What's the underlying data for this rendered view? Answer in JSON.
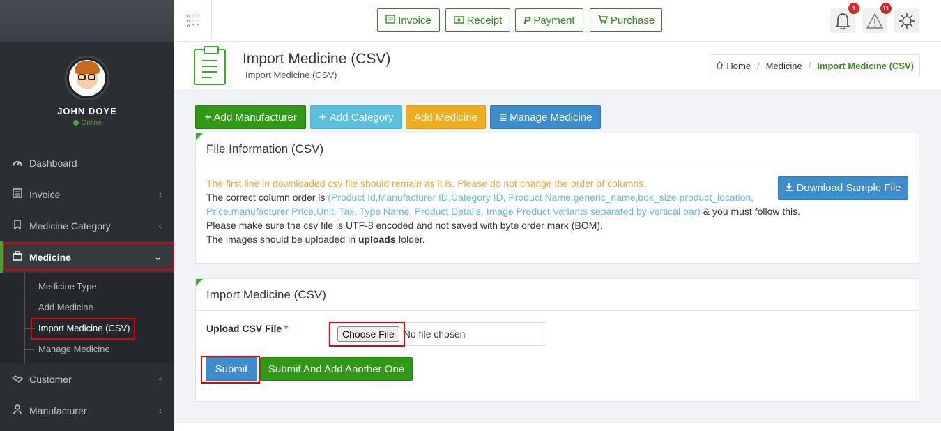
{
  "user": {
    "name": "JOHN DOYE",
    "status": "Online"
  },
  "sidebar": {
    "items": [
      {
        "label": "Dashboard",
        "icon": "dashboard-icon"
      },
      {
        "label": "Invoice",
        "icon": "invoice-icon"
      },
      {
        "label": "Medicine Category",
        "icon": "category-icon"
      },
      {
        "label": "Medicine",
        "icon": "medicine-icon"
      },
      {
        "label": "Customer",
        "icon": "handshake-icon"
      },
      {
        "label": "Manufacturer",
        "icon": "manufacturer-icon"
      }
    ],
    "submenu": [
      "Medicine Type",
      "Add Medicine",
      "Import Medicine (CSV)",
      "Manage Medicine"
    ]
  },
  "topbar": {
    "buttons": [
      "Invoice",
      "Receipt",
      "Payment",
      "Purchase"
    ],
    "notifications_count": "1",
    "alerts_count": "11"
  },
  "page": {
    "title": "Import Medicine (CSV)",
    "subtitle": "Import Medicine (CSV)",
    "breadcrumb": [
      "Home",
      "Medicine",
      "Import Medicine (CSV)"
    ]
  },
  "actions": {
    "add_manufacturer": "Add Manufacturer",
    "add_category": "Add Category",
    "add_medicine": "Add Medicine",
    "manage_medicine": "Manage Medicine"
  },
  "file_info": {
    "title": "File Information (CSV)",
    "warning": "The first line in downloaded csv file should remain as it is. Please do not change the order of columns.",
    "order_prefix": "The correct column order is ",
    "columns_line1": "(Product Id,Manufacturer ID,Category ID, Product Name,generic_name,box_size,product_location,",
    "columns_line2": "Price,manufacturer Price,Unit, Tax, Type Name, Product Details, Image Product Variants separated by vertical bar)",
    "order_suffix": " & you must follow this.",
    "encoding_note": "Please make sure the csv file is UTF-8 encoded and not saved with byte order mark (BOM).",
    "images_prefix": "The images should be uploaded in ",
    "images_folder": "uploads",
    "images_suffix": " folder.",
    "download_button": "Download Sample File"
  },
  "import_form": {
    "title": "Import Medicine (CSV)",
    "upload_label": "Upload CSV File",
    "required_mark": "*",
    "choose_file": "Choose File",
    "no_file": "No file chosen",
    "submit": "Submit",
    "submit_another": "Submit And Add Another One"
  },
  "colors": {
    "accent_green": "#39a935",
    "sidebar_bg": "#2b2f33",
    "highlight_red": "#e00000"
  }
}
